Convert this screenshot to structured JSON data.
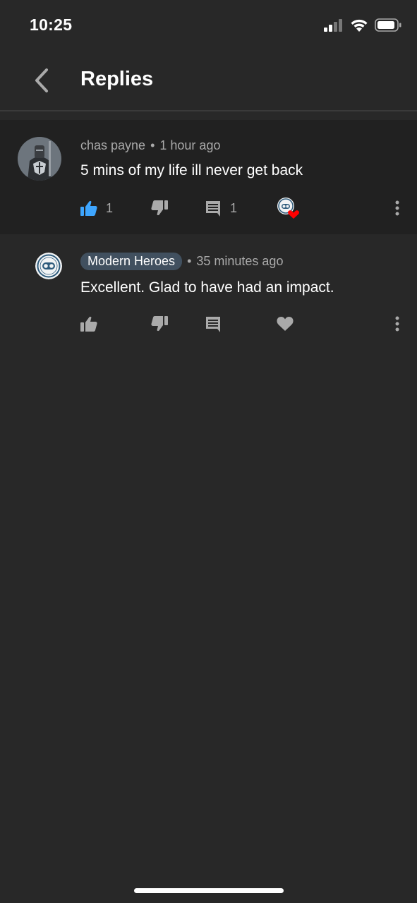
{
  "status_bar": {
    "time": "10:25"
  },
  "header": {
    "title": "Replies"
  },
  "parent_comment": {
    "author": "chas payne",
    "separator": "•",
    "time": "1 hour ago",
    "text": "5 mins of my life ill never get back",
    "like_count": "1",
    "reply_count": "1",
    "liked": true,
    "hearted_by_creator": true
  },
  "reply_comment": {
    "author": "Modern Heroes",
    "separator": "•",
    "time": "35 minutes ago",
    "text": "Excellent. Glad to have had an impact."
  },
  "colors": {
    "background": "#282828",
    "highlight_row": "#212121",
    "like_active": "#3ea6ff",
    "heart": "#ff0000",
    "icon_inactive": "#aaaaaa",
    "author_badge": "#41505f"
  },
  "icons": {
    "back": "chevron-left-icon",
    "like": "thumbs-up-icon",
    "dislike": "thumbs-down-icon",
    "reply": "comment-icon",
    "heart": "heart-icon",
    "more": "more-vert-icon"
  }
}
